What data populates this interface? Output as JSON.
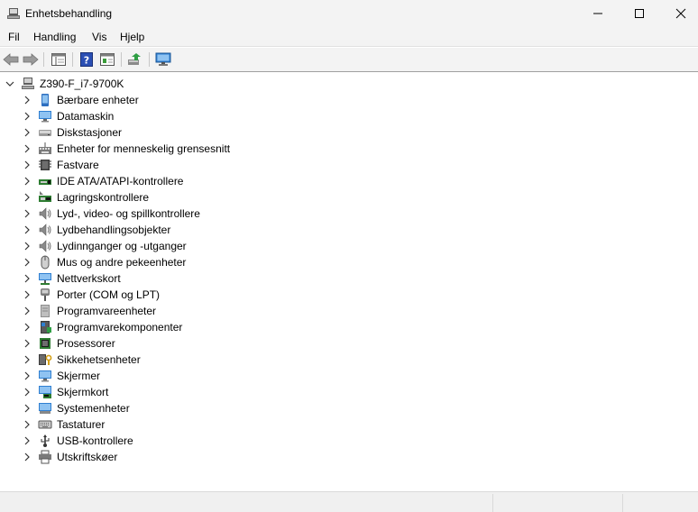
{
  "window": {
    "title": "Enhetsbehandling"
  },
  "menu": [
    "Fil",
    "Handling",
    "Vis",
    "Hjelp"
  ],
  "tree": {
    "root": "Z390-F_i7-9700K",
    "items": [
      {
        "label": "Bærbare enheter",
        "icon": "portable-device-icon"
      },
      {
        "label": "Datamaskin",
        "icon": "computer-icon"
      },
      {
        "label": "Diskstasjoner",
        "icon": "disk-drive-icon"
      },
      {
        "label": "Enheter for menneskelig grensesnitt",
        "icon": "hid-icon"
      },
      {
        "label": "Fastvare",
        "icon": "firmware-icon"
      },
      {
        "label": "IDE ATA/ATAPI-kontrollere",
        "icon": "ide-controller-icon"
      },
      {
        "label": "Lagringskontrollere",
        "icon": "storage-controller-icon"
      },
      {
        "label": "Lyd-, video- og spillkontrollere",
        "icon": "speaker-icon"
      },
      {
        "label": "Lydbehandlingsobjekter",
        "icon": "speaker-icon"
      },
      {
        "label": "Lydinnganger og -utganger",
        "icon": "speaker-icon"
      },
      {
        "label": "Mus og andre pekeenheter",
        "icon": "mouse-icon"
      },
      {
        "label": "Nettverkskort",
        "icon": "network-adapter-icon"
      },
      {
        "label": "Porter (COM og LPT)",
        "icon": "port-icon"
      },
      {
        "label": "Programvareenheter",
        "icon": "software-device-icon"
      },
      {
        "label": "Programvarekomponenter",
        "icon": "software-component-icon"
      },
      {
        "label": "Prosessorer",
        "icon": "processor-icon"
      },
      {
        "label": "Sikkehetsenheter",
        "icon": "security-device-icon"
      },
      {
        "label": "Skjermer",
        "icon": "monitor-icon"
      },
      {
        "label": "Skjermkort",
        "icon": "display-adapter-icon"
      },
      {
        "label": "Systemenheter",
        "icon": "system-device-icon"
      },
      {
        "label": "Tastaturer",
        "icon": "keyboard-icon"
      },
      {
        "label": "USB-kontrollere",
        "icon": "usb-icon"
      },
      {
        "label": "Utskriftskøer",
        "icon": "printer-icon"
      }
    ]
  },
  "colors": {
    "chrome": "#f3f3f3",
    "accent": "#1e6fc8",
    "text": "#000000"
  }
}
